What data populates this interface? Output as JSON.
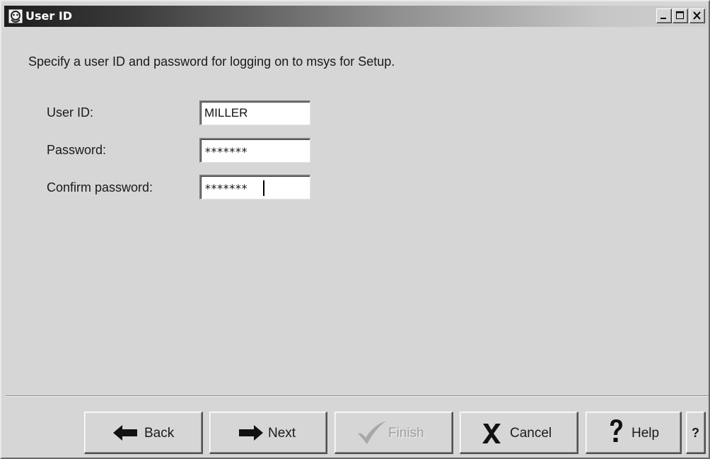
{
  "window": {
    "title": "User ID"
  },
  "message": "Specify a user ID and password for logging on to msys for Setup.",
  "form": {
    "user_id": {
      "label": "User ID:",
      "value": "MILLER"
    },
    "password": {
      "label": "Password:",
      "value": "*******"
    },
    "confirm_password": {
      "label": "Confirm password:",
      "value": "*******"
    }
  },
  "buttons": {
    "back": "Back",
    "next": "Next",
    "finish": "Finish",
    "cancel": "Cancel",
    "help": "Help",
    "context_help": "?"
  },
  "icons": {
    "app": "app-icon",
    "minimize": "minimize-icon",
    "maximize": "maximize-icon",
    "close": "close-icon",
    "back": "arrow-left-icon",
    "next": "arrow-right-icon",
    "finish": "checkmark-icon",
    "cancel": "x-icon",
    "help": "question-mark-icon"
  }
}
